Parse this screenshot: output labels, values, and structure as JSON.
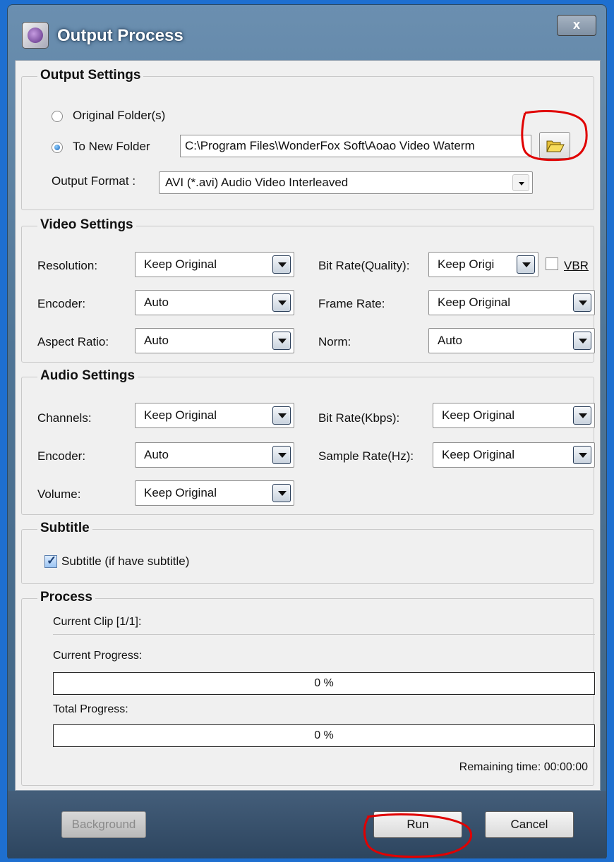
{
  "window": {
    "title": "Output Process",
    "close_label": "x"
  },
  "output_settings": {
    "legend": "Output Settings",
    "original_folder_label": "Original Folder(s)",
    "new_folder_label": "To New Folder",
    "folder_path": "C:\\Program Files\\WonderFox Soft\\Aoao Video Waterm",
    "format_label": "Output Format :",
    "format_value": "AVI  (*.avi) Audio Video Interleaved"
  },
  "video_settings": {
    "legend": "Video Settings",
    "resolution_label": "Resolution:",
    "resolution_value": "Keep Original",
    "encoder_label": "Encoder:",
    "encoder_value": "Auto",
    "aspect_label": "Aspect Ratio:",
    "aspect_value": "Auto",
    "bitrate_label": "Bit Rate(Quality):",
    "bitrate_value": "Keep Origi",
    "vbr_label": "VBR",
    "framerate_label": "Frame Rate:",
    "framerate_value": "Keep Original",
    "norm_label": "Norm:",
    "norm_value": "Auto"
  },
  "audio_settings": {
    "legend": "Audio Settings",
    "channels_label": "Channels:",
    "channels_value": "Keep Original",
    "encoder_label": "Encoder:",
    "encoder_value": "Auto",
    "volume_label": "Volume:",
    "volume_value": "Keep Original",
    "bitrate_label": "Bit Rate(Kbps):",
    "bitrate_value": "Keep Original",
    "samplerate_label": "Sample Rate(Hz):",
    "samplerate_value": "Keep Original"
  },
  "subtitle": {
    "legend": "Subtitle",
    "checkbox_label": "Subtitle (if have subtitle)"
  },
  "process": {
    "legend": "Process",
    "current_clip": "Current Clip [1/1]:",
    "current_progress_label": "Current Progress:",
    "current_progress_text": "0 %",
    "total_progress_label": "Total Progress:",
    "total_progress_text": "0 %",
    "remaining_time": "Remaining time: 00:00:00"
  },
  "footer": {
    "background_label": "Background",
    "run_label": "Run",
    "cancel_label": "Cancel"
  },
  "colors": {
    "annotation": "#e00000",
    "accent": "#1a63b8",
    "title_bar": "#4f7596"
  }
}
